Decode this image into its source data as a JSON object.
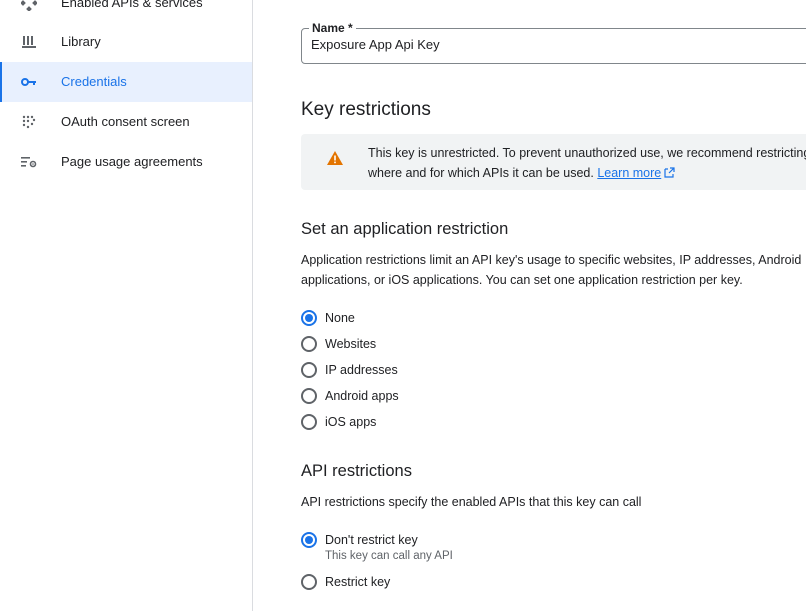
{
  "sidebar": {
    "items": [
      {
        "label": "Enabled APIs & services",
        "icon": "api-diamond-icon"
      },
      {
        "label": "Library",
        "icon": "library-icon"
      },
      {
        "label": "Credentials",
        "icon": "key-icon",
        "active": true
      },
      {
        "label": "OAuth consent screen",
        "icon": "consent-grid-icon"
      },
      {
        "label": "Page usage agreements",
        "icon": "settings-list-icon"
      }
    ]
  },
  "name_field": {
    "label": "Name *",
    "value": "Exposure App Api Key"
  },
  "key_restrictions": {
    "heading": "Key restrictions",
    "warning_line1": "This key is unrestricted. To prevent unauthorized use, we recommend restricting",
    "warning_line2": "where and for which APIs it can be used.",
    "learn_more": "Learn more"
  },
  "application_restriction": {
    "heading": "Set an application restriction",
    "description_line1": "Application restrictions limit an API key's usage to specific websites, IP addresses, Android",
    "description_line2": "applications, or iOS applications. You can set one application restriction per key.",
    "options": [
      "None",
      "Websites",
      "IP addresses",
      "Android apps",
      "iOS apps"
    ],
    "selected": "None"
  },
  "api_restrictions": {
    "heading": "API restrictions",
    "description": "API restrictions specify the enabled APIs that this key can call",
    "options": [
      "Don't restrict key",
      "Restrict key"
    ],
    "selected": "Don't restrict key",
    "dont_restrict_sublabel": "This key can call any API"
  },
  "colors": {
    "accent": "#1a73e8",
    "warning": "#e37400",
    "active_bg": "#e8f0fe"
  }
}
